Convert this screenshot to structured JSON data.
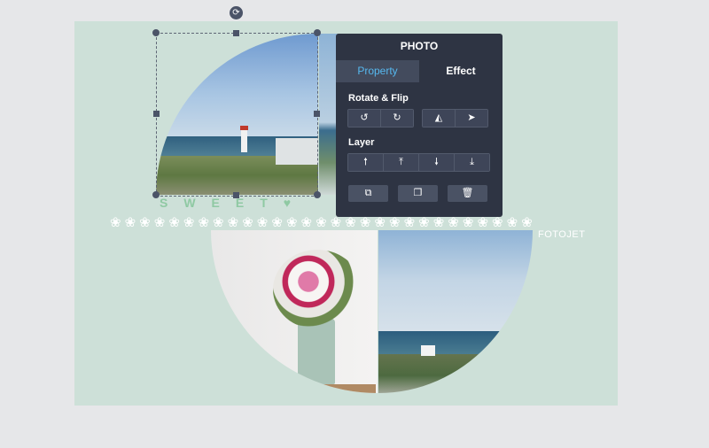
{
  "canvas": {
    "background": "#cde0d8",
    "decoration_text": "SWEET",
    "heart_icon": "heart-icon",
    "flower_glyph": "❀",
    "watermark": "FOTOJET"
  },
  "panel": {
    "title": "PHOTO",
    "tabs": [
      {
        "label": "Property",
        "active": true
      },
      {
        "label": "Effect",
        "active": false
      }
    ],
    "rotate_flip": {
      "label": "Rotate & Flip",
      "buttons": [
        {
          "icon": "rotate-left-icon",
          "glyph": "↺"
        },
        {
          "icon": "rotate-right-icon",
          "glyph": "↻"
        },
        {
          "icon": "flip-horizontal-icon",
          "glyph": "◭"
        },
        {
          "icon": "flip-vertical-icon",
          "glyph": "➤"
        }
      ]
    },
    "layer": {
      "label": "Layer",
      "buttons": [
        {
          "icon": "bring-forward-icon",
          "glyph": "🠕"
        },
        {
          "icon": "bring-to-front-icon",
          "glyph": "⤒"
        },
        {
          "icon": "send-backward-icon",
          "glyph": "🠗"
        },
        {
          "icon": "send-to-back-icon",
          "glyph": "⤓"
        }
      ]
    },
    "actions": [
      {
        "icon": "crop-icon",
        "glyph": "⧉"
      },
      {
        "icon": "duplicate-icon",
        "glyph": "❐"
      },
      {
        "icon": "delete-icon",
        "glyph": "🗑"
      }
    ]
  },
  "colors": {
    "panel_bg": "#2e3443",
    "tab_active_text": "#56b8ef",
    "accent_green": "#8fc9a3"
  }
}
